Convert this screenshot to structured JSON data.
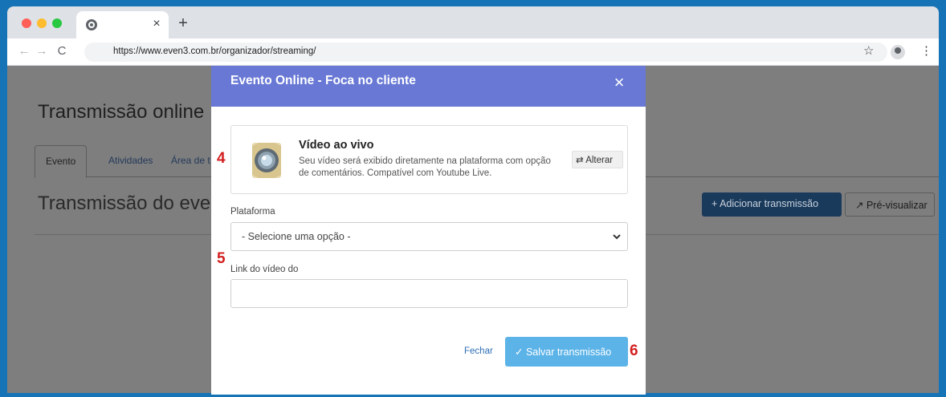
{
  "browser": {
    "tab_close": "×",
    "new_tab": "+",
    "back": "←",
    "forward": "→",
    "reload": "C",
    "url": "https://www.even3.com.br/organizador/streaming/",
    "bookmark": "☆",
    "menu": "⋮"
  },
  "page": {
    "title": "Transmissão online",
    "tabs": [
      "Evento",
      "Atividades",
      "Área de t"
    ],
    "section_title": "Transmissão do event",
    "add_button": "+  Adicionar transmissão",
    "preview_button": "Pré-visualizar",
    "preview_icon": "↗"
  },
  "modal": {
    "title": "Evento Online - Foca no cliente",
    "close": "×",
    "card": {
      "title": "Vídeo ao vivo",
      "description": "Seu vídeo será exibido diretamente na plataforma com opção de comentários. Compatível com Youtube Live.",
      "change_icon": "⇄",
      "change_label": "Alterar"
    },
    "platform_label": "Plataforma",
    "platform_selected": "- Selecione uma opção -",
    "link_label": "Link do vídeo do",
    "link_value": "",
    "cancel_label": "Fechar",
    "save_label": "✓  Salvar transmissão"
  },
  "steps": [
    "4",
    "5",
    "6"
  ],
  "colors": {
    "frame": "#1573b6",
    "modal_header": "#6878d4",
    "save_button": "#5bb3e8",
    "step_marker": "#d31f1f"
  }
}
